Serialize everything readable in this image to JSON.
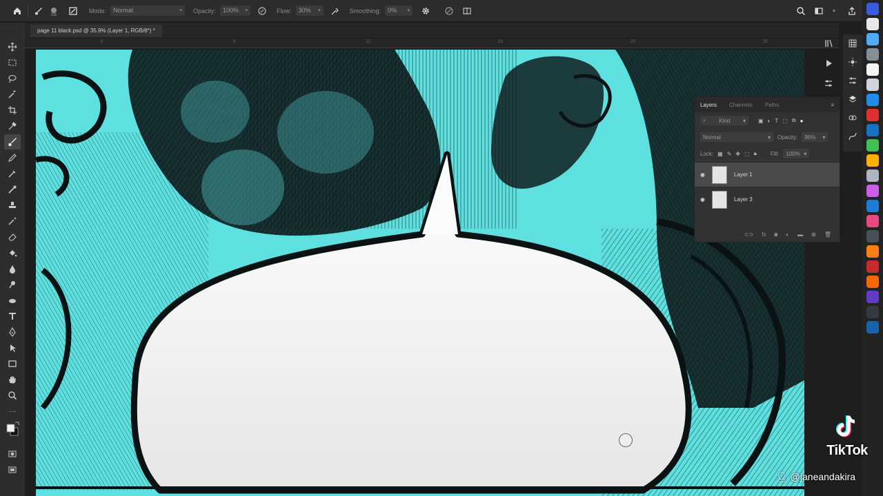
{
  "options_bar": {
    "mode_label": "Mode:",
    "mode_value": "Normal",
    "opacity_label": "Opacity:",
    "opacity_value": "100%",
    "flow_label": "Flow:",
    "flow_value": "30%",
    "smoothing_label": "Smoothing:",
    "smoothing_value": "0%"
  },
  "document_tab": {
    "title": "page 11 black.psd @ 35.9% (Layer 1, RGB/8*) *",
    "close": "×"
  },
  "ruler_ticks": [
    "0",
    "5",
    "10",
    "15",
    "20",
    "25"
  ],
  "layers_panel": {
    "tabs": [
      "Layers",
      "Channels",
      "Paths"
    ],
    "filter_kind": "Kind",
    "blend_mode": "Normal",
    "opacity_label": "Opacity:",
    "opacity_value": "96%",
    "lock_label": "Lock:",
    "fill_label": "Fill:",
    "fill_value": "100%",
    "layers": [
      {
        "name": "Layer 1",
        "selected": true
      },
      {
        "name": "Layer 3",
        "selected": false
      }
    ]
  },
  "watermark": {
    "brand": "TikTok",
    "user": "@janeandakira"
  },
  "colors": {
    "canvas_cyan": "#5fe0e0",
    "ink": "#0b1214",
    "bubble": "#fbfbfb"
  }
}
